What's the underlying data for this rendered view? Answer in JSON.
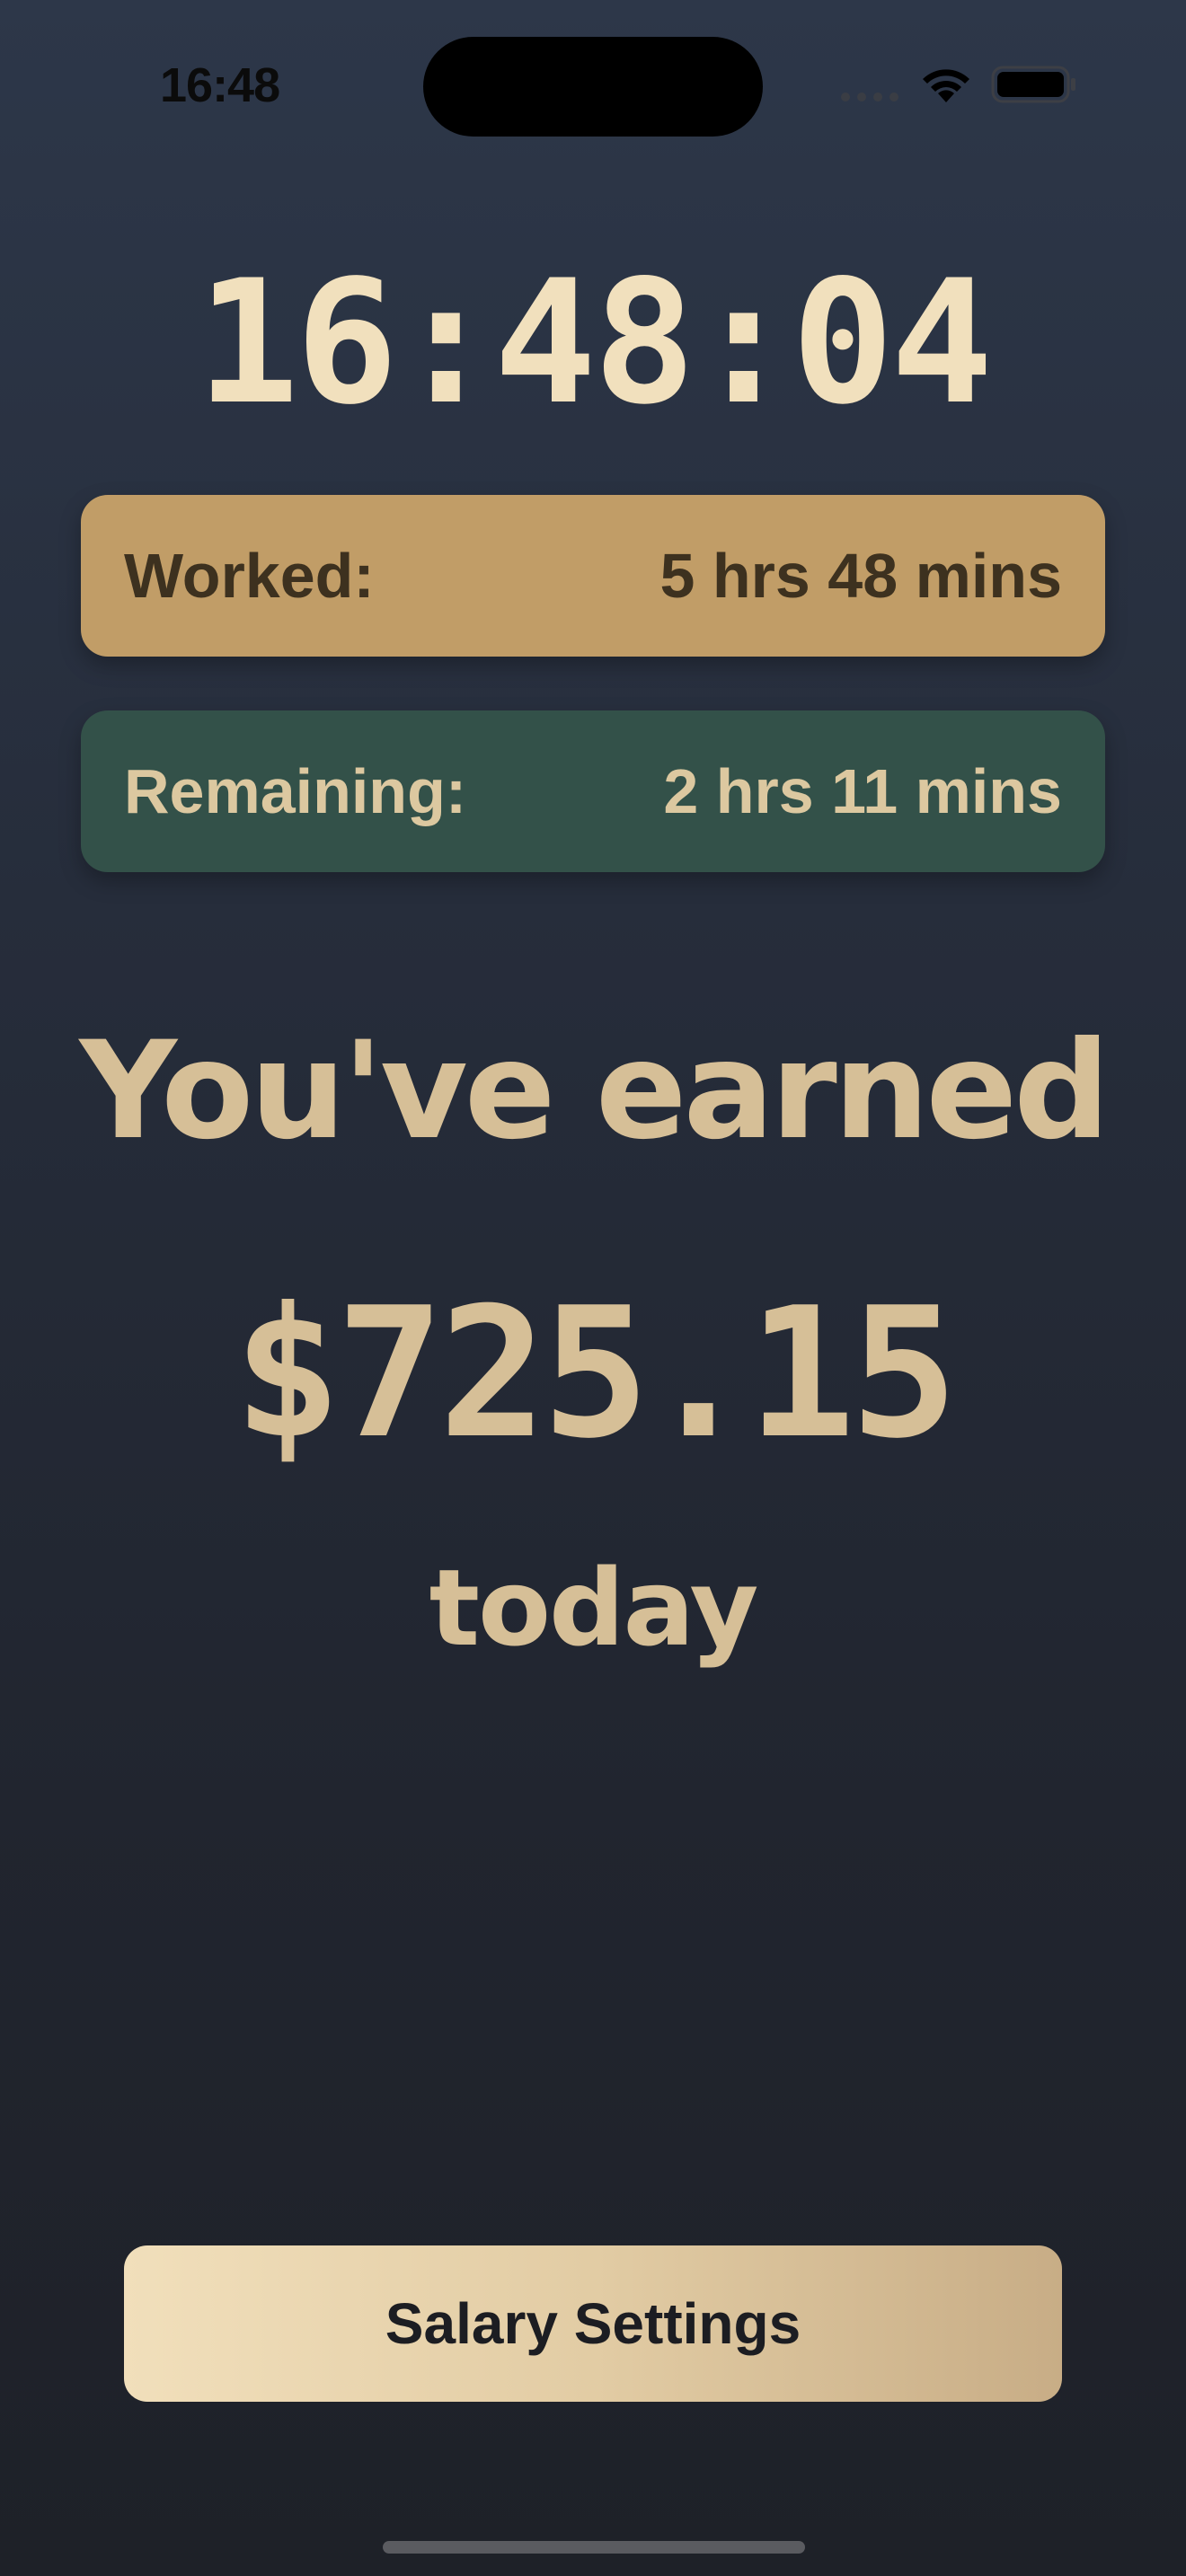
{
  "status_bar": {
    "time": "16:48",
    "icons": [
      "signal-icon",
      "wifi-icon",
      "battery-icon"
    ]
  },
  "clock": {
    "time": "16:48:04"
  },
  "worked": {
    "label": "Worked:",
    "value": "5 hrs 48 mins"
  },
  "remaining": {
    "label": "Remaining:",
    "value": "2 hrs 11 mins"
  },
  "earnings": {
    "heading": "You've earned",
    "amount": "$725.15",
    "suffix": "today"
  },
  "settings_button": {
    "label": "Salary Settings"
  },
  "colors": {
    "background_top": "#2d3749",
    "background_bottom": "#1e2128",
    "accent_gold": "#c19d67",
    "accent_green": "#335149",
    "text_cream": "#f1e0bd",
    "text_tan": "#d6bf97"
  }
}
